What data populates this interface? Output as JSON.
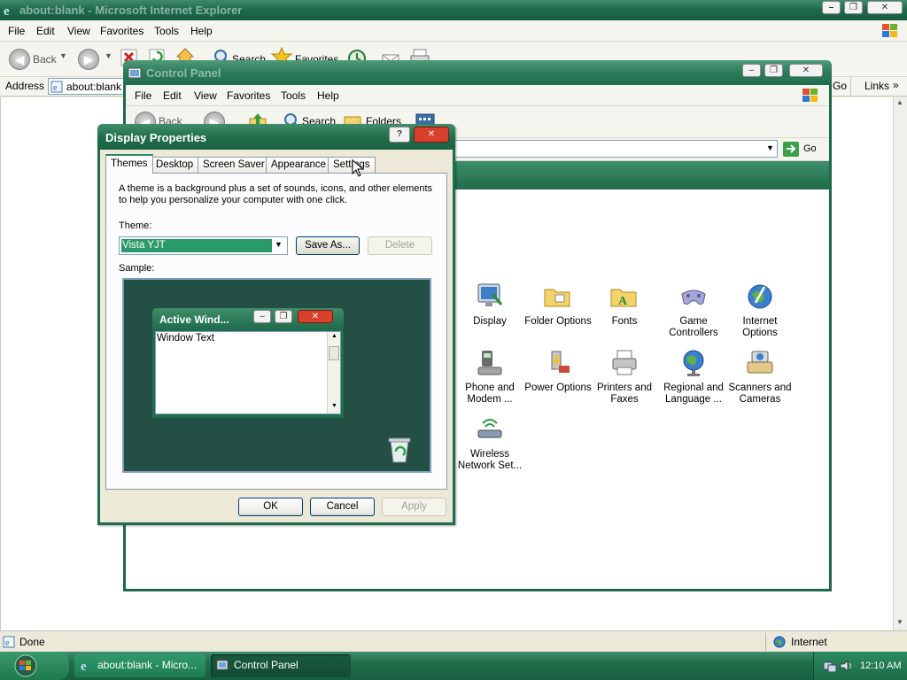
{
  "ie": {
    "title": "about:blank - Microsoft Internet Explorer",
    "menu": [
      "File",
      "Edit",
      "View",
      "Favorites",
      "Tools",
      "Help"
    ],
    "toolbar": {
      "back": "Back",
      "search": "Search",
      "favorites": "Favorites"
    },
    "address_label": "Address",
    "address_value": "about:blank",
    "go": "Go",
    "links": "Links",
    "status": "Done",
    "zone": "Internet"
  },
  "cp": {
    "title": "Control Panel",
    "menu": [
      "File",
      "Edit",
      "View",
      "Favorites",
      "Tools",
      "Help"
    ],
    "toolbar": {
      "back": "Back",
      "search": "Search",
      "folders": "Folders"
    },
    "go": "Go",
    "icons": [
      {
        "label": "Display",
        "icon": "display-icon"
      },
      {
        "label": "Folder Options",
        "icon": "folder-options-icon"
      },
      {
        "label": "Fonts",
        "icon": "fonts-icon"
      },
      {
        "label": "Game Controllers",
        "icon": "game-controllers-icon"
      },
      {
        "label": "Internet Options",
        "icon": "internet-options-icon"
      },
      {
        "label": "Phone and Modem ...",
        "icon": "phone-modem-icon"
      },
      {
        "label": "Power Options",
        "icon": "power-options-icon"
      },
      {
        "label": "Printers and Faxes",
        "icon": "printers-icon"
      },
      {
        "label": "Regional and Language ...",
        "icon": "regional-icon"
      },
      {
        "label": "Scanners and Cameras",
        "icon": "scanners-icon"
      },
      {
        "label": "Wireless Network Set...",
        "icon": "wireless-icon"
      }
    ]
  },
  "dialog": {
    "title": "Display Properties",
    "tabs": [
      "Themes",
      "Desktop",
      "Screen Saver",
      "Appearance",
      "Settings"
    ],
    "active_tab": "Themes",
    "description": "A theme is a background plus a set of sounds, icons, and other elements to help you personalize your computer with one click.",
    "theme_label": "Theme:",
    "theme_value": "Vista YJT",
    "save_as": "Save As...",
    "delete": "Delete",
    "sample_label": "Sample:",
    "sample_window_title": "Active Wind...",
    "sample_window_text": "Window Text",
    "ok": "OK",
    "cancel": "Cancel",
    "apply": "Apply"
  },
  "taskbar": {
    "tasks": [
      "about:blank - Micro...",
      "Control Panel"
    ],
    "clock": "12:10 AM"
  },
  "colors": {
    "theme_green": "#1f6c4b",
    "selection_green": "#2a9a6a"
  }
}
